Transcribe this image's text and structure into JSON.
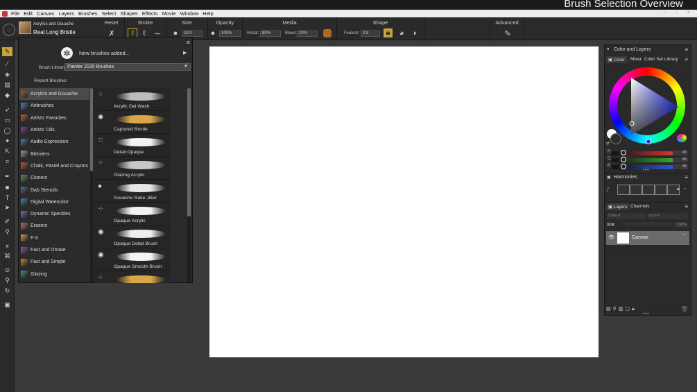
{
  "window": {
    "title": "Brush Selection Overview",
    "controls": "– ▫ ×"
  },
  "menu": [
    "File",
    "Edit",
    "Canvas",
    "Layers",
    "Brushes",
    "Select",
    "Shapes",
    "Effects",
    "Movie",
    "Window",
    "Help"
  ],
  "property_bar": {
    "brush_category": "Acrylics and Gouache",
    "brush_variant": "Real Long Bristle",
    "groups": {
      "reset": "Reset",
      "stroke": "Stroke",
      "size": "Size",
      "opacity": "Opacity",
      "media": "Media",
      "shape": "Shape",
      "advanced": "Advanced"
    },
    "size_value": "18.0",
    "opacity_value": "100%",
    "resat_label": "Resat:",
    "resat_value": "80%",
    "bleed_label": "Bleed:",
    "bleed_value": "20%",
    "feature_label": "Feature:",
    "feature_value": "2.8"
  },
  "brush_selector": {
    "new_brushes": "New brushes added...",
    "library_label": "Brush Library:",
    "library_value": "Painter 2020 Brushes",
    "recent_label": "Recent Brushes:",
    "categories": [
      {
        "label": "Acrylics and Gouache",
        "color": "#8a6a3a"
      },
      {
        "label": "Airbrushes",
        "color": "#5b7fa6"
      },
      {
        "label": "Artists' Favorites",
        "color": "#b3643a"
      },
      {
        "label": "Artists' Oils",
        "color": "#7a4a8a"
      },
      {
        "label": "Audio Expression",
        "color": "#4a7aa6"
      },
      {
        "label": "Blenders",
        "color": "#9a9a9a"
      },
      {
        "label": "Chalk, Pastel and Crayons",
        "color": "#c25a3a"
      },
      {
        "label": "Cloners",
        "color": "#6a8a5a"
      },
      {
        "label": "Dab Stencils",
        "color": "#5a6a8a"
      },
      {
        "label": "Digital Watercolor",
        "color": "#3a8aaa"
      },
      {
        "label": "Dynamic Speckles",
        "color": "#7a6aa6"
      },
      {
        "label": "Erasers",
        "color": "#c26a7a"
      },
      {
        "label": "F-X",
        "color": "#c2a23a"
      },
      {
        "label": "Fast and Ornate",
        "color": "#8a5a9a"
      },
      {
        "label": "Fast and Simple",
        "color": "#c28a3a"
      },
      {
        "label": "Glazing",
        "color": "#4a8a8a"
      }
    ],
    "variants": [
      {
        "label": "Acrylic Gel Wash",
        "stroke": "#bdbdbd"
      },
      {
        "label": "Captured Bristle",
        "stroke": "#d9a64a"
      },
      {
        "label": "Detail Opaque",
        "stroke": "#f2f2f2"
      },
      {
        "label": "Glazing Acrylic",
        "stroke": "#c8c8c8"
      },
      {
        "label": "Gouache Rake Jitter",
        "stroke": "#e6e6e6"
      },
      {
        "label": "Opaque Acrylic",
        "stroke": "#f2f2f2"
      },
      {
        "label": "Opaque Detail Brush",
        "stroke": "#eeeeee"
      },
      {
        "label": "Opaque Smooth Brush",
        "stroke": "#f4f4f4"
      },
      {
        "label": "",
        "stroke": "#d9a64a"
      }
    ]
  },
  "color_panel": {
    "panel_title": "Color and Layers",
    "tabs": [
      "Color",
      "Mixer",
      "Color Set Library"
    ],
    "rgb": [
      {
        "label": "R",
        "value": "45",
        "color": "#d33"
      },
      {
        "label": "G",
        "value": "45",
        "color": "#3a3"
      },
      {
        "label": "B",
        "value": "45",
        "color": "#35c"
      }
    ],
    "harmonies_title": "Harmonies",
    "layers_tabs": [
      "Layers",
      "Channels"
    ],
    "blend_mode": "Default",
    "composite": "Ignore",
    "layer_opacity": "100%",
    "layer_name": "Canvas"
  }
}
